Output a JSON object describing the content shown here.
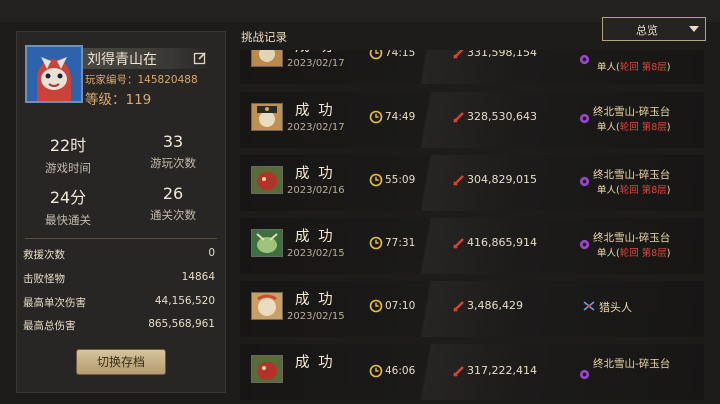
{
  "profile": {
    "name": "刘得青山在",
    "player_id": "玩家编号：145820488",
    "level": "等级：119"
  },
  "stats": [
    {
      "value": "22时",
      "label": "游戏时间"
    },
    {
      "value": "33",
      "label": "游玩次数"
    },
    {
      "value": "24分",
      "label": "最快通关"
    },
    {
      "value": "26",
      "label": "通关次数"
    }
  ],
  "details": [
    {
      "label": "救援次数",
      "value": "0"
    },
    {
      "label": "击败怪物",
      "value": "14864"
    },
    {
      "label": "最高单次伤害",
      "value": "44,156,520"
    },
    {
      "label": "最高总伤害",
      "value": "865,568,961"
    }
  ],
  "switch_button": "切换存档",
  "section_title": "挑战记录",
  "filter": {
    "selected": "总览"
  },
  "records": [
    {
      "result": "成 功",
      "date": "2023/02/17",
      "time": "74:15",
      "damage": "331,598,154",
      "stage": "",
      "mode_prefix": "单人(",
      "mode_red": "轮回 第8层",
      "mode_suffix": ")",
      "hunter": ""
    },
    {
      "result": "成 功",
      "date": "2023/02/17",
      "time": "74:49",
      "damage": "328,530,643",
      "stage": "终北雪山-碎玉台",
      "mode_prefix": "单人(",
      "mode_red": "轮回 第8层",
      "mode_suffix": ")",
      "hunter": ""
    },
    {
      "result": "成 功",
      "date": "2023/02/16",
      "time": "55:09",
      "damage": "304,829,015",
      "stage": "终北雪山-碎玉台",
      "mode_prefix": "单人(",
      "mode_red": "轮回 第8层",
      "mode_suffix": ")",
      "hunter": ""
    },
    {
      "result": "成 功",
      "date": "2023/02/15",
      "time": "77:31",
      "damage": "416,865,914",
      "stage": "终北雪山-碎玉台",
      "mode_prefix": "单人(",
      "mode_red": "轮回 第8层",
      "mode_suffix": ")",
      "hunter": ""
    },
    {
      "result": "成 功",
      "date": "2023/02/15",
      "time": "07:10",
      "damage": "3,486,429",
      "stage": "",
      "mode_prefix": "",
      "mode_red": "",
      "mode_suffix": "",
      "hunter": "猎头人"
    },
    {
      "result": "成 功",
      "date": "",
      "time": "46:06",
      "damage": "317,222,414",
      "stage": "终北雪山-碎玉台",
      "mode_prefix": "",
      "mode_red": "",
      "mode_suffix": "",
      "hunter": ""
    }
  ],
  "colors": {
    "gold": "#d9a86a",
    "mode_red": "#e0473a",
    "clock": "#e8c43a",
    "damage": "#d8442e",
    "swirl": "#9b45c9"
  }
}
